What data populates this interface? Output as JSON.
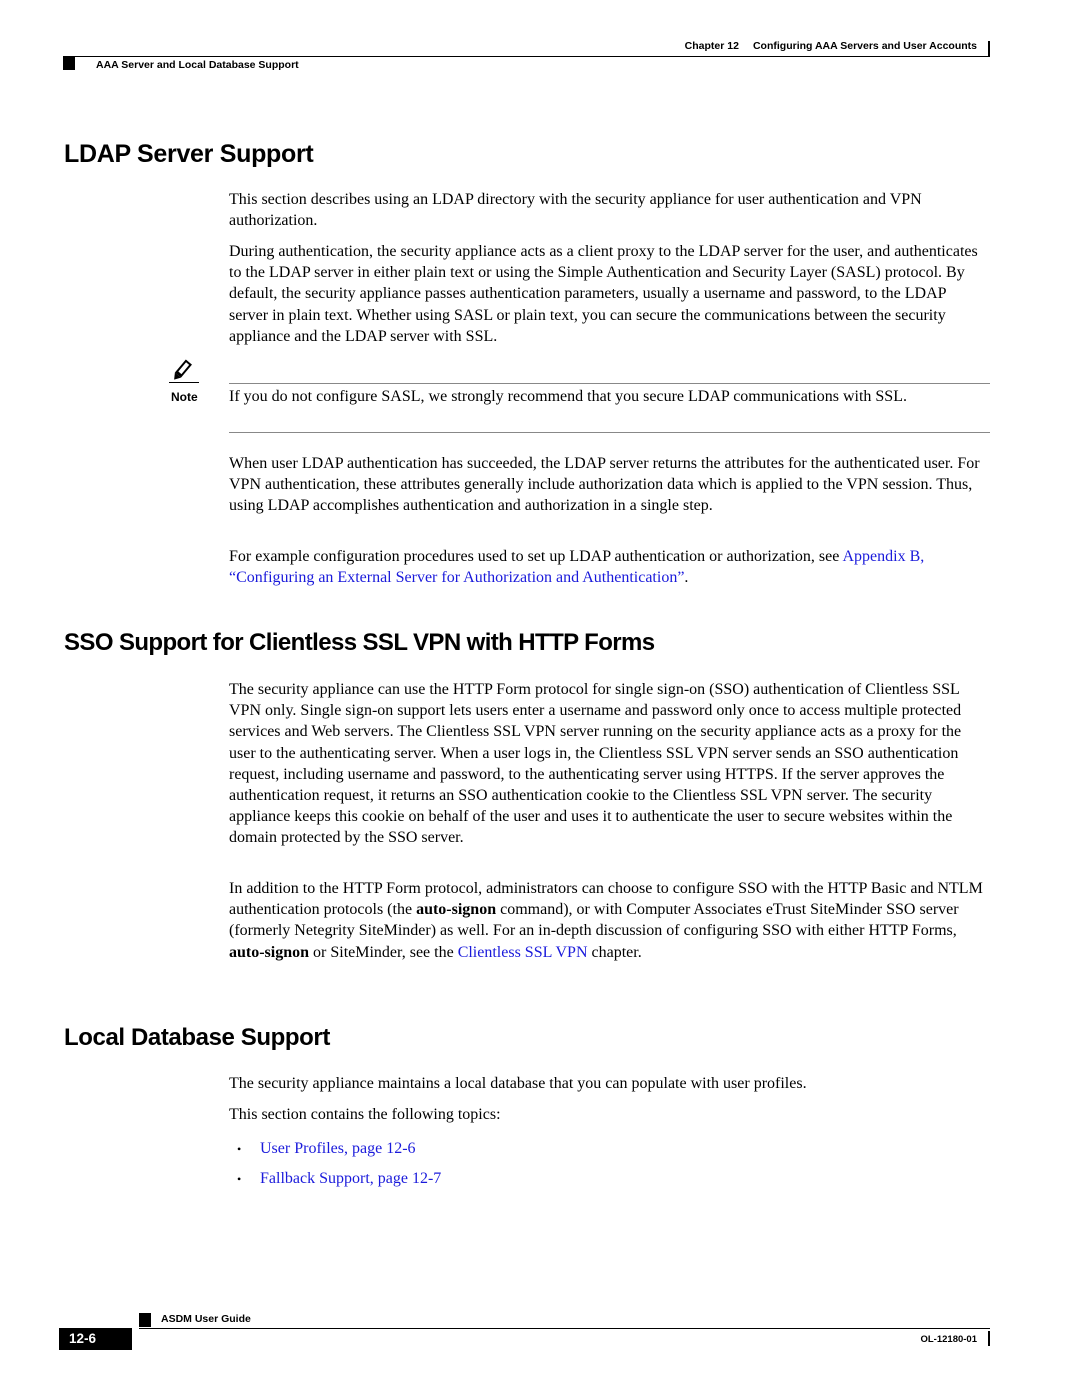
{
  "header": {
    "chapter_number": "Chapter 12",
    "chapter_title": "Configuring AAA Servers and User Accounts",
    "section_title": "AAA Server and Local Database Support"
  },
  "sections": {
    "ldap": {
      "title": "LDAP Server Support",
      "p1": "This section describes using an LDAP directory with the security appliance for user authentication and VPN authorization.",
      "p2": "During authentication, the security appliance acts as a client proxy to the LDAP server for the user, and authenticates to the LDAP server in either plain text or using the Simple Authentication and Security Layer (SASL) protocol. By default, the security appliance passes authentication parameters, usually a username and password, to the LDAP server in plain text. Whether using SASL or plain text, you can secure the communications between the security appliance and the LDAP server with SSL.",
      "note": {
        "label": "Note",
        "icon": "pencil-note-icon",
        "text": "If you do not configure SASL, we strongly recommend that you secure LDAP communications with SSL."
      },
      "p3": "When user LDAP authentication has succeeded, the LDAP server returns the attributes for the authenticated user. For VPN authentication, these attributes generally include authorization data which is applied to the VPN session. Thus, using LDAP accomplishes authentication and authorization in a single step.",
      "p4_text": "For example configuration procedures used to set up LDAP authentication or authorization, see ",
      "p4_link": "Appendix B, “Configuring an External Server for Authorization and Authentication”",
      "p4_end": "."
    },
    "sso": {
      "title": "SSO Support for Clientless SSL VPN with HTTP Forms",
      "p1": "The security appliance can use the HTTP Form protocol for single sign-on (SSO) authentication of Clientless SSL VPN only. Single sign-on support lets users enter a username and password only once to access multiple protected services and Web servers. The Clientless SSL VPN server running on the security appliance acts as a proxy for the user to the authenticating server. When a user logs in, the Clientless SSL VPN server sends an SSO authentication request, including username and password, to the authenticating server using HTTPS. If the server approves the authentication request, it returns an SSO authentication cookie to the Clientless SSL VPN server. The security appliance keeps this cookie on behalf of the user and uses it to authenticate the user to secure websites within the domain protected by the SSO server.",
      "p2_a": "In addition to the HTTP Form protocol, administrators can choose to configure SSO with the HTTP Basic and NTLM authentication protocols (the ",
      "p2_cmd1": "auto-signon",
      "p2_b": " command), or with Computer Associates eTrust SiteMinder SSO server (formerly Netegrity SiteMinder) as well. For an in-depth discussion of configuring SSO with either HTTP Forms, ",
      "p2_cmd2": "auto-signon",
      "p2_c": " or SiteMinder, see the ",
      "p2_link": "Clientless SSL VPN",
      "p2_d": " chapter."
    },
    "local": {
      "title": "Local Database Support",
      "p1": "The security appliance maintains a local database that you can populate with user profiles.",
      "p2": "This section contains the following topics:",
      "bullets": [
        {
          "label": "User Profiles, page 12-6"
        },
        {
          "label": "Fallback Support, page 12-7"
        }
      ],
      "bullet_glyph": "•"
    }
  },
  "footer": {
    "guide_title": "ASDM User Guide",
    "page_number": "12-6",
    "doc_id": "OL-12180-01"
  },
  "colors": {
    "link": "#1a1adb",
    "text": "#000000"
  }
}
